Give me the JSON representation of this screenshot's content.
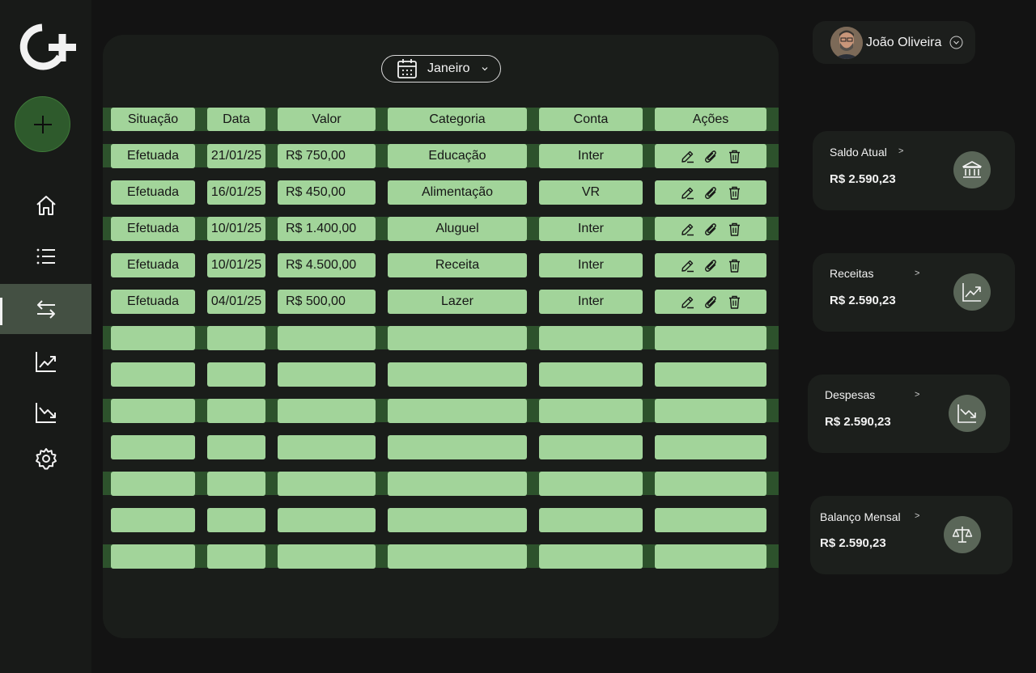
{
  "month_selector": {
    "label": "Janeiro",
    "icon": "calendar-icon"
  },
  "table": {
    "headers": [
      "Situação",
      "Data",
      "Valor",
      "Categoria",
      "Conta",
      "Ações"
    ],
    "rows": [
      {
        "situacao": "Efetuada",
        "data": "21/01/25",
        "valor": "R$ 750,00",
        "categoria": "Educação",
        "conta": "Inter"
      },
      {
        "situacao": "Efetuada",
        "data": "16/01/25",
        "valor": "R$ 450,00",
        "categoria": "Alimentação",
        "conta": "VR"
      },
      {
        "situacao": "Efetuada",
        "data": "10/01/25",
        "valor": "R$ 1.400,00",
        "categoria": "Aluguel",
        "conta": "Inter"
      },
      {
        "situacao": "Efetuada",
        "data": "10/01/25",
        "valor": "R$ 4.500,00",
        "categoria": "Receita",
        "conta": "Inter"
      },
      {
        "situacao": "Efetuada",
        "data": "04/01/25",
        "valor": "R$ 500,00",
        "categoria": "Lazer",
        "conta": "Inter"
      }
    ],
    "action_icons": [
      "edit-icon",
      "attach-icon",
      "delete-icon"
    ]
  },
  "user": {
    "name": "João Oliveira"
  },
  "cards": [
    {
      "title": "Saldo Atual",
      "arrow": ">",
      "value": "R$ 2.590,23",
      "icon": "bank-icon"
    },
    {
      "title": "Receitas",
      "arrow": ">",
      "value": "R$ 2.590,23",
      "icon": "trend-up-icon"
    },
    {
      "title": "Despesas",
      "arrow": ">",
      "value": "R$ 2.590,23",
      "icon": "trend-down-icon"
    },
    {
      "title": "Balanço Mensal",
      "arrow": ">",
      "value": "R$ 2.590,23",
      "icon": "scale-icon"
    }
  ],
  "colors": {
    "background": "#131313",
    "sidebar": "#181a18",
    "panel": "#1a1d1a",
    "band": "#2d522c",
    "cell": "#a2d49a",
    "active_nav": "#445043"
  }
}
